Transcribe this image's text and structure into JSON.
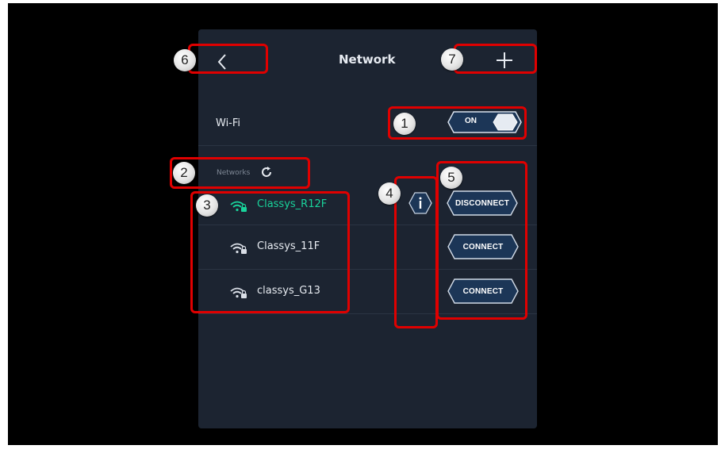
{
  "header": {
    "title": "Network"
  },
  "wifi": {
    "label": "Wi-Fi",
    "toggle_label": "ON"
  },
  "networks": {
    "label": "Networks",
    "items": [
      {
        "name": "Classys_R12F",
        "action": "DISCONNECT",
        "connected": true
      },
      {
        "name": "Classys_11F",
        "action": "CONNECT",
        "connected": false
      },
      {
        "name": "classys_G13",
        "action": "CONNECT",
        "connected": false
      }
    ]
  },
  "callouts": [
    "1",
    "2",
    "3",
    "4",
    "5",
    "6",
    "7"
  ],
  "colors": {
    "panel": "#1c2431",
    "accent_green": "#19d39b",
    "highlight_red": "#e00000"
  },
  "icons": [
    "back-chevron-icon",
    "plus-icon",
    "refresh-icon",
    "wifi-lock-icon",
    "info-icon"
  ]
}
